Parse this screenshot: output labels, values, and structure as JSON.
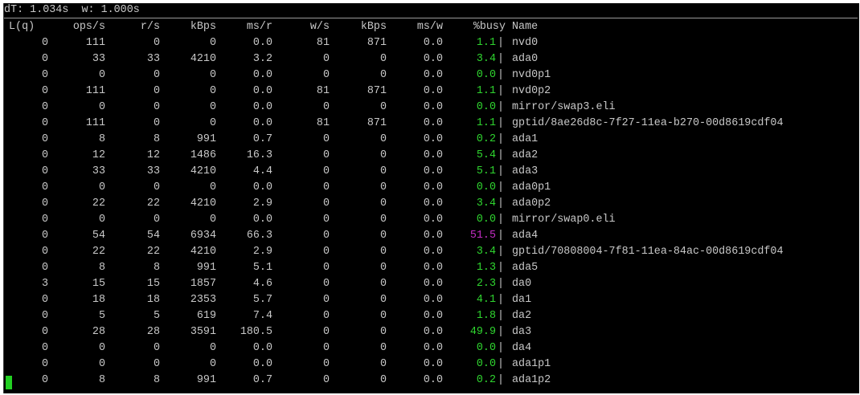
{
  "summary": {
    "dT_label": "dT:",
    "dT_value": "1.034s",
    "w_label": "w:",
    "w_value": "1.000s"
  },
  "columns": [
    "L(q)",
    "ops/s",
    "r/s",
    "kBps",
    "ms/r",
    "w/s",
    "kBps",
    "ms/w",
    "%busy",
    "Name"
  ],
  "colors": {
    "background": "#000000",
    "text": "#c8c8c8",
    "busy_normal": "#2fd42f",
    "busy_high": "#c22dc2",
    "cursor": "#22d022"
  },
  "rows": [
    {
      "lq": "0",
      "ops": "111",
      "rs": "0",
      "kbr": "0",
      "msr": "0.0",
      "ws": "81",
      "kbw": "871",
      "msw": "0.0",
      "busy": "1.1",
      "name": "nvd0"
    },
    {
      "lq": "0",
      "ops": "33",
      "rs": "33",
      "kbr": "4210",
      "msr": "3.2",
      "ws": "0",
      "kbw": "0",
      "msw": "0.0",
      "busy": "3.4",
      "name": "ada0"
    },
    {
      "lq": "0",
      "ops": "0",
      "rs": "0",
      "kbr": "0",
      "msr": "0.0",
      "ws": "0",
      "kbw": "0",
      "msw": "0.0",
      "busy": "0.0",
      "name": "nvd0p1"
    },
    {
      "lq": "0",
      "ops": "111",
      "rs": "0",
      "kbr": "0",
      "msr": "0.0",
      "ws": "81",
      "kbw": "871",
      "msw": "0.0",
      "busy": "1.1",
      "name": "nvd0p2"
    },
    {
      "lq": "0",
      "ops": "0",
      "rs": "0",
      "kbr": "0",
      "msr": "0.0",
      "ws": "0",
      "kbw": "0",
      "msw": "0.0",
      "busy": "0.0",
      "name": "mirror/swap3.eli"
    },
    {
      "lq": "0",
      "ops": "111",
      "rs": "0",
      "kbr": "0",
      "msr": "0.0",
      "ws": "81",
      "kbw": "871",
      "msw": "0.0",
      "busy": "1.1",
      "name": "gptid/8ae26d8c-7f27-11ea-b270-00d8619cdf04"
    },
    {
      "lq": "0",
      "ops": "8",
      "rs": "8",
      "kbr": "991",
      "msr": "0.7",
      "ws": "0",
      "kbw": "0",
      "msw": "0.0",
      "busy": "0.2",
      "name": "ada1"
    },
    {
      "lq": "0",
      "ops": "12",
      "rs": "12",
      "kbr": "1486",
      "msr": "16.3",
      "ws": "0",
      "kbw": "0",
      "msw": "0.0",
      "busy": "5.4",
      "name": "ada2"
    },
    {
      "lq": "0",
      "ops": "33",
      "rs": "33",
      "kbr": "4210",
      "msr": "4.4",
      "ws": "0",
      "kbw": "0",
      "msw": "0.0",
      "busy": "5.1",
      "name": "ada3"
    },
    {
      "lq": "0",
      "ops": "0",
      "rs": "0",
      "kbr": "0",
      "msr": "0.0",
      "ws": "0",
      "kbw": "0",
      "msw": "0.0",
      "busy": "0.0",
      "name": "ada0p1"
    },
    {
      "lq": "0",
      "ops": "22",
      "rs": "22",
      "kbr": "4210",
      "msr": "2.9",
      "ws": "0",
      "kbw": "0",
      "msw": "0.0",
      "busy": "3.4",
      "name": "ada0p2"
    },
    {
      "lq": "0",
      "ops": "0",
      "rs": "0",
      "kbr": "0",
      "msr": "0.0",
      "ws": "0",
      "kbw": "0",
      "msw": "0.0",
      "busy": "0.0",
      "name": "mirror/swap0.eli"
    },
    {
      "lq": "0",
      "ops": "54",
      "rs": "54",
      "kbr": "6934",
      "msr": "66.3",
      "ws": "0",
      "kbw": "0",
      "msw": "0.0",
      "busy": "51.5",
      "name": "ada4",
      "high": true
    },
    {
      "lq": "0",
      "ops": "22",
      "rs": "22",
      "kbr": "4210",
      "msr": "2.9",
      "ws": "0",
      "kbw": "0",
      "msw": "0.0",
      "busy": "3.4",
      "name": "gptid/70808004-7f81-11ea-84ac-00d8619cdf04"
    },
    {
      "lq": "0",
      "ops": "8",
      "rs": "8",
      "kbr": "991",
      "msr": "5.1",
      "ws": "0",
      "kbw": "0",
      "msw": "0.0",
      "busy": "1.3",
      "name": "ada5"
    },
    {
      "lq": "3",
      "ops": "15",
      "rs": "15",
      "kbr": "1857",
      "msr": "4.6",
      "ws": "0",
      "kbw": "0",
      "msw": "0.0",
      "busy": "2.3",
      "name": "da0"
    },
    {
      "lq": "0",
      "ops": "18",
      "rs": "18",
      "kbr": "2353",
      "msr": "5.7",
      "ws": "0",
      "kbw": "0",
      "msw": "0.0",
      "busy": "4.1",
      "name": "da1"
    },
    {
      "lq": "0",
      "ops": "5",
      "rs": "5",
      "kbr": "619",
      "msr": "7.4",
      "ws": "0",
      "kbw": "0",
      "msw": "0.0",
      "busy": "1.8",
      "name": "da2"
    },
    {
      "lq": "0",
      "ops": "28",
      "rs": "28",
      "kbr": "3591",
      "msr": "180.5",
      "ws": "0",
      "kbw": "0",
      "msw": "0.0",
      "busy": "49.9",
      "name": "da3"
    },
    {
      "lq": "0",
      "ops": "0",
      "rs": "0",
      "kbr": "0",
      "msr": "0.0",
      "ws": "0",
      "kbw": "0",
      "msw": "0.0",
      "busy": "0.0",
      "name": "da4"
    },
    {
      "lq": "0",
      "ops": "0",
      "rs": "0",
      "kbr": "0",
      "msr": "0.0",
      "ws": "0",
      "kbw": "0",
      "msw": "0.0",
      "busy": "0.0",
      "name": "ada1p1"
    },
    {
      "lq": "0",
      "ops": "8",
      "rs": "8",
      "kbr": "991",
      "msr": "0.7",
      "ws": "0",
      "kbw": "0",
      "msw": "0.0",
      "busy": "0.2",
      "name": "ada1p2"
    }
  ]
}
